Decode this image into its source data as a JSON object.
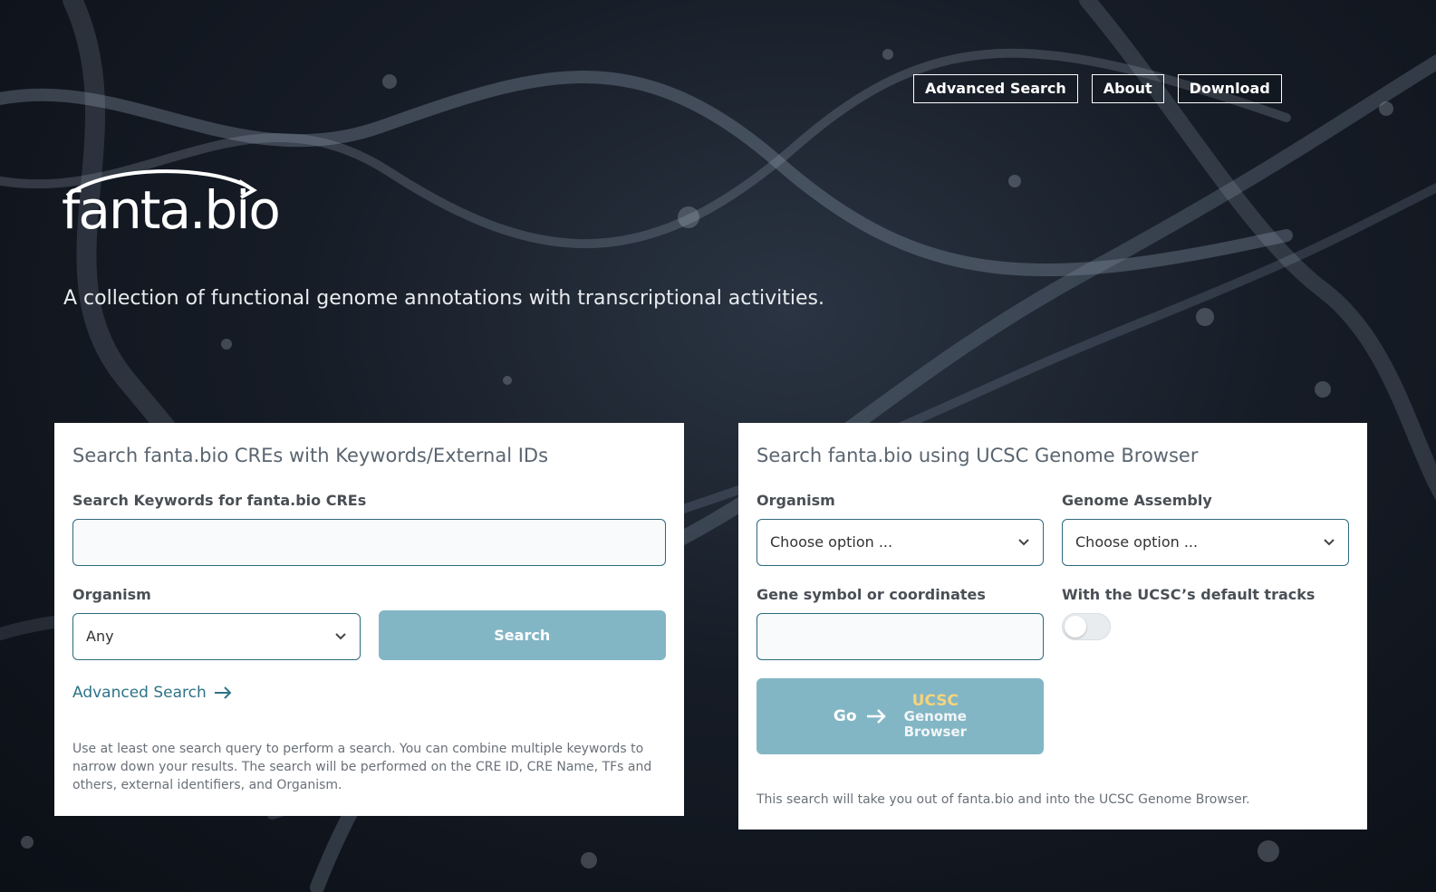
{
  "nav": {
    "advanced_search": "Advanced Search",
    "about": "About",
    "download": "Download"
  },
  "logo": {
    "text": "fanta.bio"
  },
  "tagline": "A collection of functional genome annotations with transcriptional activities.",
  "left_card": {
    "title": "Search fanta.bio CREs with Keywords/External IDs",
    "keywords_label": "Search Keywords for fanta.bio CREs",
    "keywords_value": "",
    "organism_label": "Organism",
    "organism_selected": "Any",
    "search_button": "Search",
    "advanced_link": "Advanced Search",
    "note": "Use at least one search query to perform a search. You can combine multiple keywords to narrow down your results. The search will be performed on the CRE ID, CRE Name, TFs and others, external identifiers, and Organism."
  },
  "right_card": {
    "title": "Search fanta.bio using UCSC Genome Browser",
    "organism_label": "Organism",
    "organism_selected": "Choose option ...",
    "assembly_label": "Genome Assembly",
    "assembly_selected": "Choose option ...",
    "gene_label": "Gene symbol or coordinates",
    "gene_value": "",
    "tracks_label": "With the UCSC’s default tracks",
    "go_label": "Go",
    "ucsc_line1": "UCSC",
    "ucsc_line2": "Genome",
    "ucsc_line3": "Browser",
    "note": "This search will take you out of fanta.bio and into the UCSC Genome Browser."
  },
  "colors": {
    "accent": "#2e6a7d",
    "button": "#83b6c5",
    "ucsc_yellow": "#f6d47b"
  }
}
